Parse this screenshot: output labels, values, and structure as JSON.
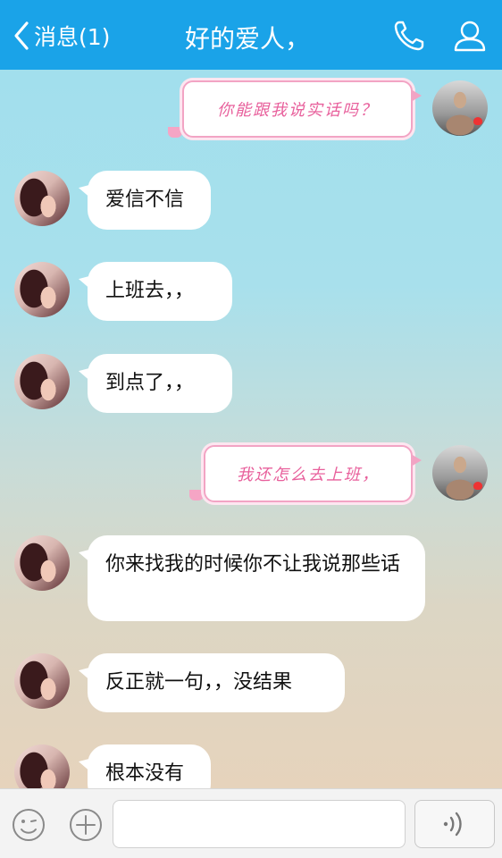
{
  "header": {
    "back_label": "消息(1)",
    "title": "好的爱人，",
    "background": "#1aa3e8"
  },
  "messages": [
    {
      "from": "me",
      "text": "你能跟我说实话吗？"
    },
    {
      "from": "her",
      "text": "爱信不信"
    },
    {
      "from": "her",
      "text": "上班去，，"
    },
    {
      "from": "her",
      "text": "到点了，，"
    },
    {
      "from": "me",
      "text": "我还怎么去上班，"
    },
    {
      "from": "her",
      "text": "你来找我的时候你不让我说那些话"
    },
    {
      "from": "her",
      "text": "反正就一句，，没结果"
    },
    {
      "from": "her",
      "text": "根本没有"
    }
  ],
  "input": {
    "placeholder": "",
    "emoji_icon": "smiley-icon",
    "plus_icon": "plus-circle-icon",
    "voice_icon": "voice-wave-icon"
  }
}
